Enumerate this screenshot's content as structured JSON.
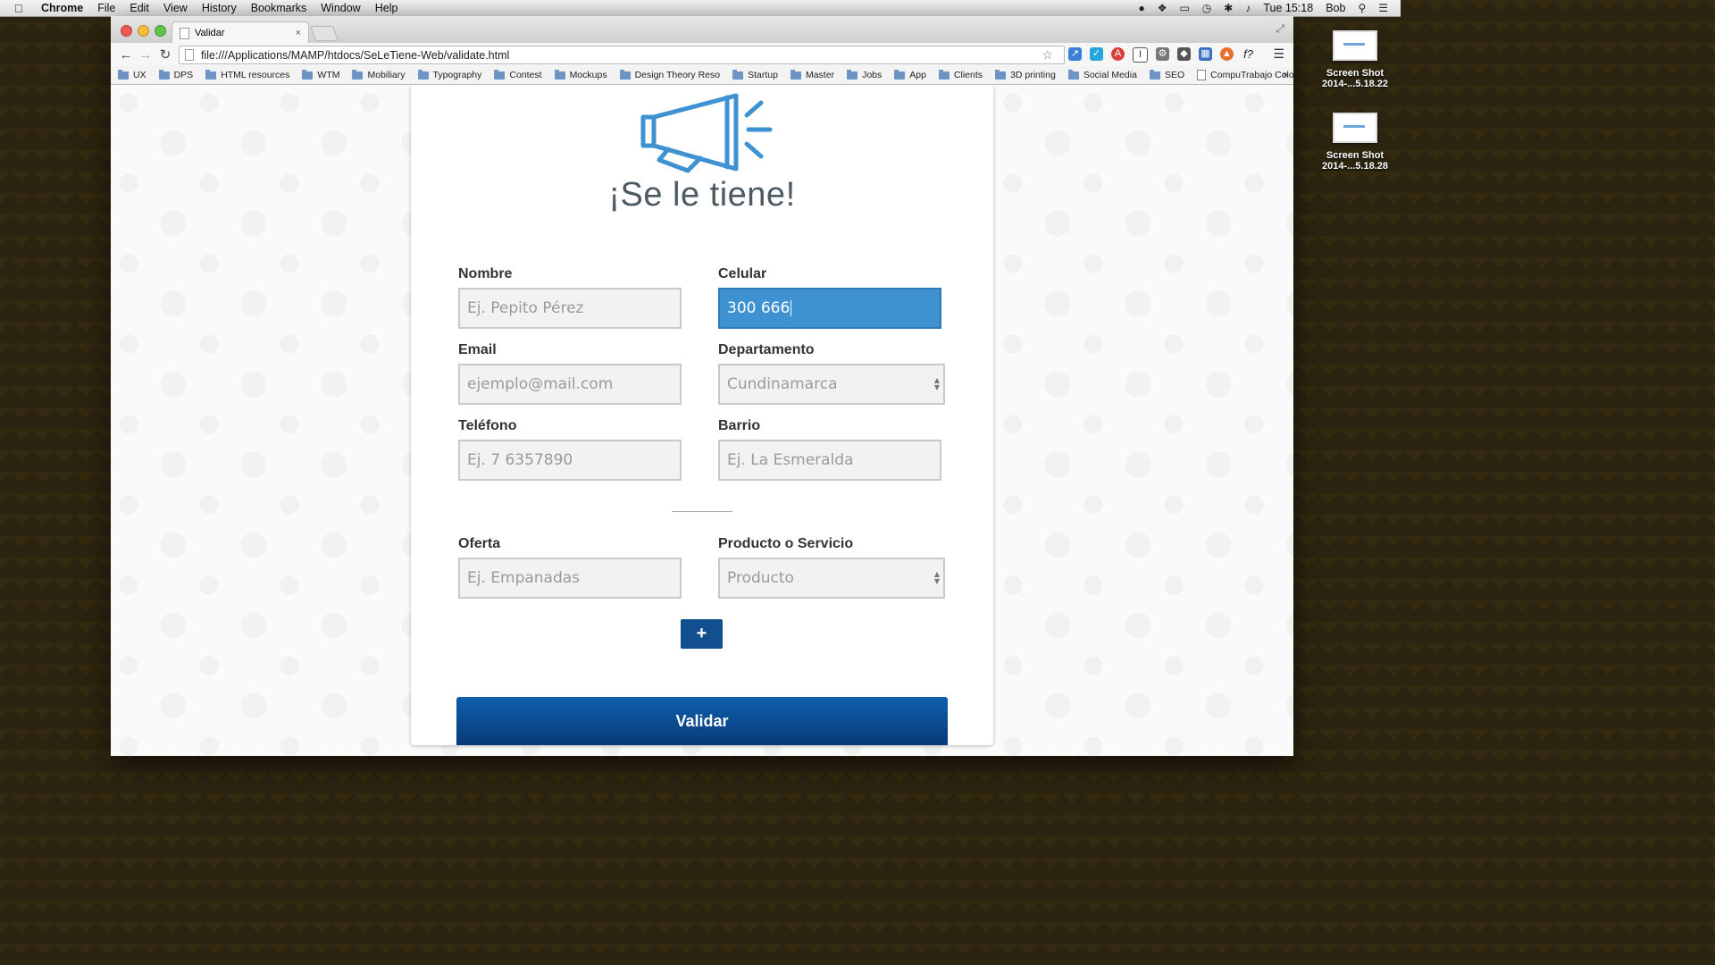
{
  "menubar": {
    "app_name": "Chrome",
    "items": [
      "File",
      "Edit",
      "View",
      "History",
      "Bookmarks",
      "Window",
      "Help"
    ],
    "clock": "Tue 15:18",
    "user": "Bob"
  },
  "desktop": {
    "icons": [
      {
        "label_line1": "Screen Shot",
        "label_line2": "2014-...5.18.22"
      },
      {
        "label_line1": "Screen Shot",
        "label_line2": "2014-...5.18.28"
      }
    ]
  },
  "browser": {
    "tab_title": "Validar",
    "tab_close": "×",
    "url": "file:///Applications/MAMP/htdocs/SeLeTiene-Web/validate.html",
    "bookmarks": [
      {
        "label": "UX",
        "type": "folder"
      },
      {
        "label": "DPS",
        "type": "folder"
      },
      {
        "label": "HTML resources",
        "type": "folder"
      },
      {
        "label": "WTM",
        "type": "folder"
      },
      {
        "label": "Mobiliary",
        "type": "folder"
      },
      {
        "label": "Typography",
        "type": "folder"
      },
      {
        "label": "Contest",
        "type": "folder"
      },
      {
        "label": "Mockups",
        "type": "folder"
      },
      {
        "label": "Design Theory Reso",
        "type": "folder"
      },
      {
        "label": "Startup",
        "type": "folder"
      },
      {
        "label": "Master",
        "type": "folder"
      },
      {
        "label": "Jobs",
        "type": "folder"
      },
      {
        "label": "App",
        "type": "folder"
      },
      {
        "label": "Clients",
        "type": "folder"
      },
      {
        "label": "3D printing",
        "type": "folder"
      },
      {
        "label": "Social Media",
        "type": "folder"
      },
      {
        "label": "SEO",
        "type": "folder"
      },
      {
        "label": "CompuTrabajo Colo",
        "type": "page"
      }
    ],
    "bookmarks_more": "»"
  },
  "page": {
    "brand": "¡Se le tiene!",
    "logo_icon": "megaphone-icon",
    "accent_color": "#3e92d1",
    "button_color": "#124f8e",
    "fields": {
      "nombre": {
        "label": "Nombre",
        "placeholder": "Ej. Pepito Pérez"
      },
      "celular": {
        "label": "Celular",
        "value": "300 666"
      },
      "email": {
        "label": "Email",
        "placeholder": "ejemplo@mail.com"
      },
      "departamento": {
        "label": "Departamento",
        "selected": "Cundinamarca"
      },
      "telefono": {
        "label": "Teléfono",
        "placeholder": "Ej. 7 6357890"
      },
      "barrio": {
        "label": "Barrio",
        "placeholder": "Ej. La Esmeralda"
      },
      "oferta": {
        "label": "Oferta",
        "placeholder": "Ej. Empanadas"
      },
      "producto": {
        "label": "Producto o Servicio",
        "selected": "Producto"
      }
    },
    "add_button": "+",
    "submit_button": "Validar"
  }
}
